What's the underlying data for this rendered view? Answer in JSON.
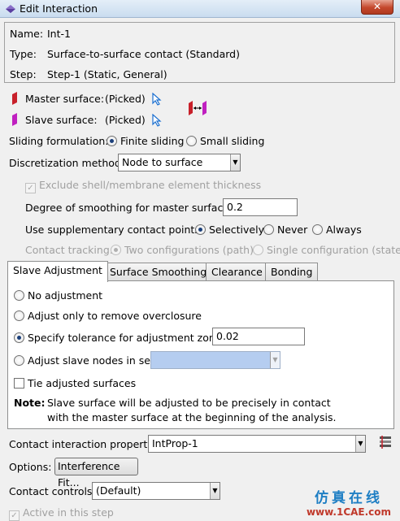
{
  "window": {
    "title": "Edit Interaction",
    "close_glyph": "✕"
  },
  "info": {
    "name_label": "Name:",
    "name_value": "Int-1",
    "type_label": "Type:",
    "type_value": "Surface-to-surface contact (Standard)",
    "step_label": "Step:",
    "step_value": "Step-1 (Static, General)"
  },
  "surfaces": {
    "master_label": "Master surface:",
    "master_value": "(Picked)",
    "slave_label": "Slave surface:",
    "slave_value": "(Picked)",
    "master_color": "#c8202a",
    "slave_color": "#c020c0"
  },
  "sliding": {
    "label": "Sliding formulation:",
    "options": [
      "Finite sliding",
      "Small sliding"
    ],
    "selected": "Finite sliding"
  },
  "discretization": {
    "label": "Discretization method:",
    "value": "Node to surface"
  },
  "exclude_shell": {
    "label": "Exclude shell/membrane element thickness",
    "checked": true,
    "enabled": false
  },
  "smoothing": {
    "label": "Degree of smoothing for master surface:",
    "value": "0.2"
  },
  "supplementary": {
    "label": "Use supplementary contact points:",
    "options": [
      "Selectively",
      "Never",
      "Always"
    ],
    "selected": "Selectively"
  },
  "tracking": {
    "label": "Contact tracking:",
    "options": [
      "Two configurations (path)",
      "Single configuration (state)"
    ],
    "selected": "Two configurations (path)",
    "enabled": false
  },
  "tabs": [
    "Slave Adjustment",
    "Surface Smoothing",
    "Clearance",
    "Bonding"
  ],
  "active_tab": "Slave Adjustment",
  "slave_adjustment": {
    "options": [
      "No adjustment",
      "Adjust only to remove overclosure",
      "Specify tolerance for adjustment zone:",
      "Adjust slave nodes in set:"
    ],
    "selected": "Specify tolerance for adjustment zone:",
    "tolerance_value": "0.02",
    "tie_label": "Tie adjusted surfaces",
    "note_label": "Note:",
    "note_line1": "Slave surface will be adjusted to be precisely in contact",
    "note_line2": "with the master surface at the beginning of the analysis."
  },
  "property": {
    "label": "Contact interaction property:",
    "value": "IntProp-1"
  },
  "options_row": {
    "label": "Options:",
    "button": "Interference Fit..."
  },
  "controls": {
    "label": "Contact controls:",
    "value": "(Default)"
  },
  "active_step": {
    "label": "Active in this step",
    "checked": true,
    "enabled": false
  },
  "watermark": {
    "line1": "仿真在线",
    "line2": "www.1CAE.com"
  }
}
